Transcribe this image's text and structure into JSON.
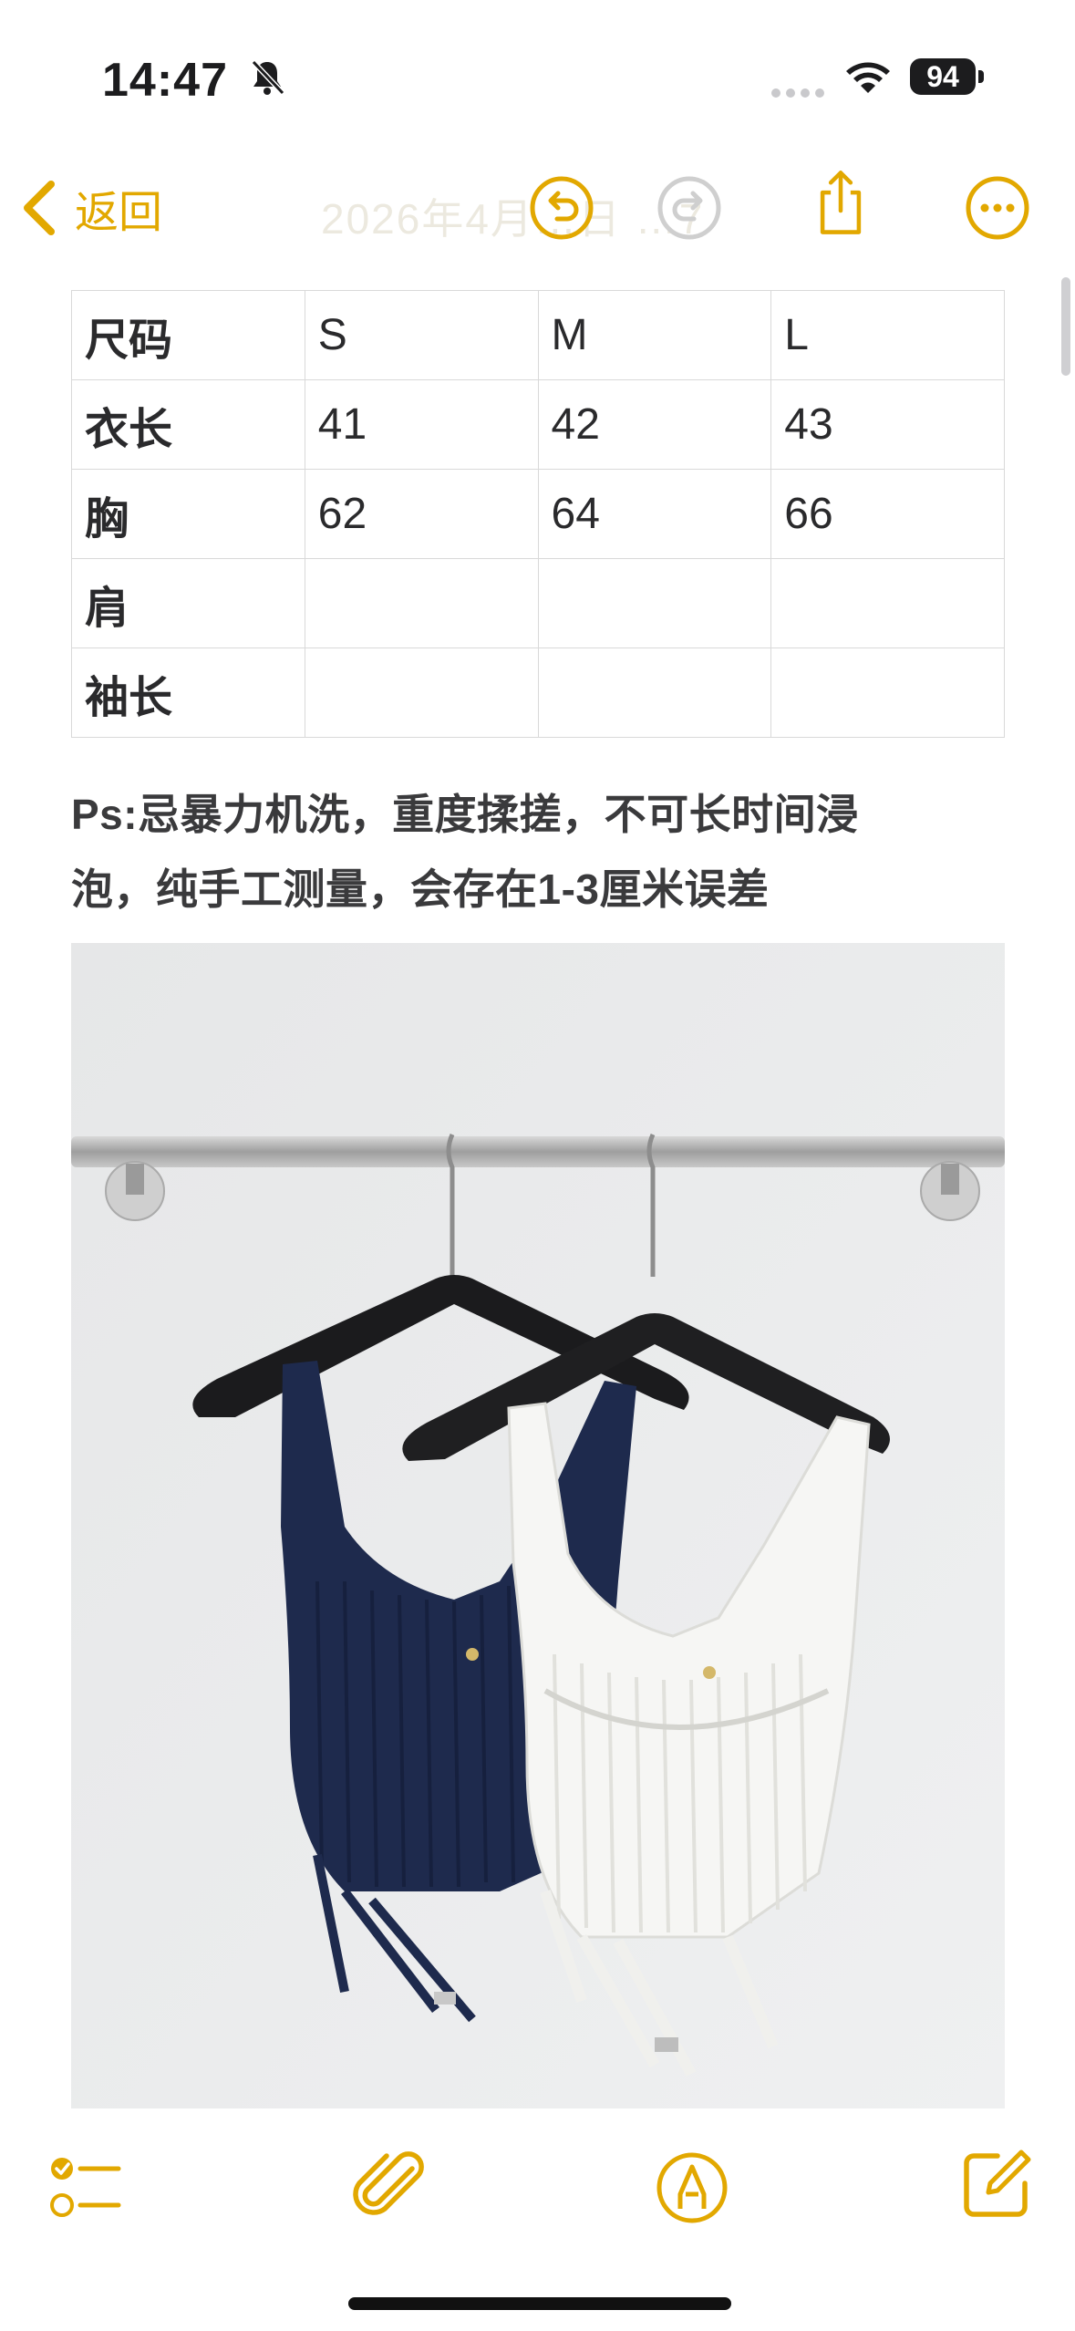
{
  "status_bar": {
    "time": "14:47",
    "battery": "94"
  },
  "nav": {
    "back_label": "返回",
    "title_ghost": "2026年4月…日 …7"
  },
  "table": {
    "header": [
      "尺码",
      "S",
      "M",
      "L"
    ],
    "rows": [
      [
        "衣长",
        "41",
        "42",
        "43"
      ],
      [
        "胸",
        "62",
        "64",
        "66"
      ],
      [
        "肩",
        "",
        "",
        ""
      ],
      [
        "袖长",
        "",
        "",
        ""
      ]
    ]
  },
  "note": {
    "line1": "Ps:忌暴力机洗，重度揉搓，不可长时间浸",
    "line2": "泡，纯手工测量，会存在1-3厘米误差"
  },
  "icons": {
    "accent": "#e2a800",
    "nav": [
      "chevron-left-icon",
      "undo-icon",
      "redo-icon",
      "share-icon",
      "more-icon"
    ],
    "toolbar": [
      "checklist-icon",
      "paperclip-icon",
      "markup-pen-icon",
      "compose-icon"
    ]
  },
  "photo": {
    "subject": "navy and white knit camisole tops on black hangers"
  }
}
